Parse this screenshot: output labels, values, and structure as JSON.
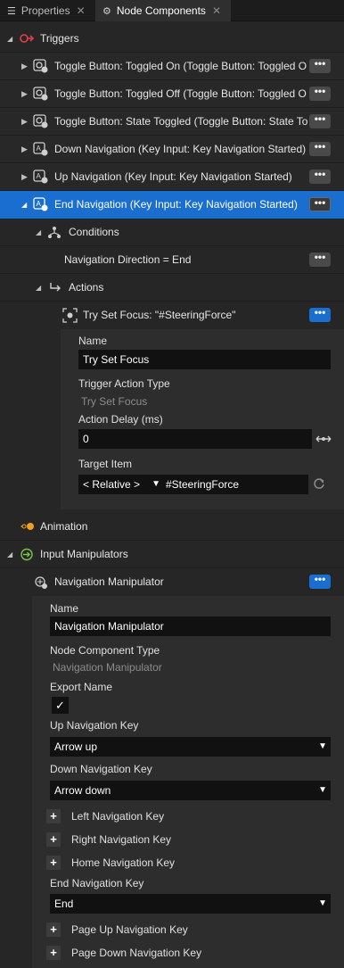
{
  "tabs": [
    {
      "label": "Properties",
      "close": "✕"
    },
    {
      "label": "Node Components",
      "close": "✕"
    }
  ],
  "triggers_header": "Triggers",
  "triggers": [
    {
      "label": "Toggle Button: Toggled On (Toggle Button: Toggled O",
      "more": "•••"
    },
    {
      "label": "Toggle Button: Toggled Off (Toggle Button: Toggled O",
      "more": "•••"
    },
    {
      "label": "Toggle Button: State Toggled (Toggle Button: State Tog",
      "more": "•••"
    },
    {
      "label": "Down Navigation (Key Input: Key Navigation Started)",
      "more": "•••"
    },
    {
      "label": "Up Navigation (Key Input: Key Navigation Started)",
      "more": "•••"
    },
    {
      "label": "End Navigation (Key Input: Key Navigation Started)",
      "more": "•••"
    }
  ],
  "conditions": {
    "header": "Conditions",
    "item": "Navigation Direction = End",
    "more": "•••"
  },
  "actions": {
    "header": "Actions",
    "item": "Try Set Focus: \"#SteeringForce\"",
    "more": "•••",
    "props": {
      "name_label": "Name",
      "name_value": "Try Set Focus",
      "type_label": "Trigger Action Type",
      "type_value": "Try Set Focus",
      "delay_label": "Action Delay (ms)",
      "delay_value": "0",
      "target_label": "Target Item",
      "target_mode": "< Relative >",
      "target_value": "#SteeringForce"
    }
  },
  "animation_header": "Animation",
  "input_manipulators_header": "Input Manipulators",
  "nav_manipulator": {
    "header": "Navigation Manipulator",
    "more": "•••",
    "name_label": "Name",
    "name_value": "Navigation Manipulator",
    "type_label": "Node Component Type",
    "type_value": "Navigation Manipulator",
    "export_label": "Export Name",
    "export_check": "✓",
    "up_label": "Up Navigation Key",
    "up_value": "Arrow up",
    "down_label": "Down Navigation Key",
    "down_value": "Arrow down",
    "left_label": "Left Navigation Key",
    "right_label": "Right Navigation Key",
    "home_label": "Home Navigation Key",
    "end_label": "End Navigation Key",
    "end_value": "End",
    "pageup_label": "Page Up Navigation Key",
    "pagedown_label": "Page Down Navigation Key",
    "plus": "+"
  },
  "colors": {
    "selection": "#1a6ed0",
    "trigger_icon": "#e0404a",
    "animation_icon": "#f0a020",
    "manipulator_icon": "#7cc44a"
  }
}
